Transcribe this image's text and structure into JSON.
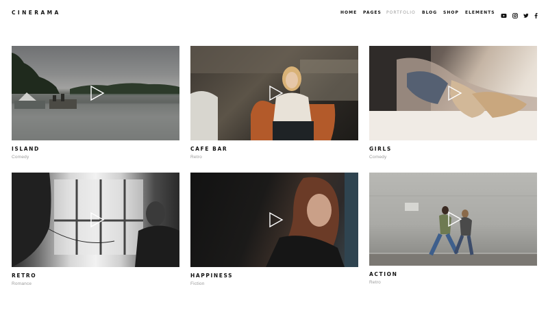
{
  "brand": {
    "logo_text": "CINERAMA"
  },
  "nav": {
    "items": [
      {
        "label": "HOME",
        "active": false
      },
      {
        "label": "PAGES",
        "active": false
      },
      {
        "label": "PORTFOLIO",
        "active": true
      },
      {
        "label": "BLOG",
        "active": false
      },
      {
        "label": "SHOP",
        "active": false
      },
      {
        "label": "ELEMENTS",
        "active": false
      }
    ]
  },
  "social": [
    "youtube-icon",
    "instagram-icon",
    "twitter-icon",
    "facebook-icon"
  ],
  "portfolio": {
    "items": [
      {
        "title": "ISLAND",
        "category": "Comedy"
      },
      {
        "title": "CAFE BAR",
        "category": "Retro"
      },
      {
        "title": "GIRLS",
        "category": "Comedy"
      },
      {
        "title": "RETRO",
        "category": "Romance"
      },
      {
        "title": "HAPPINESS",
        "category": "Fiction"
      },
      {
        "title": "ACTION",
        "category": "Retro"
      }
    ]
  },
  "colors": {
    "text": "#111111",
    "muted": "#9a9a9a",
    "background": "#ffffff"
  }
}
